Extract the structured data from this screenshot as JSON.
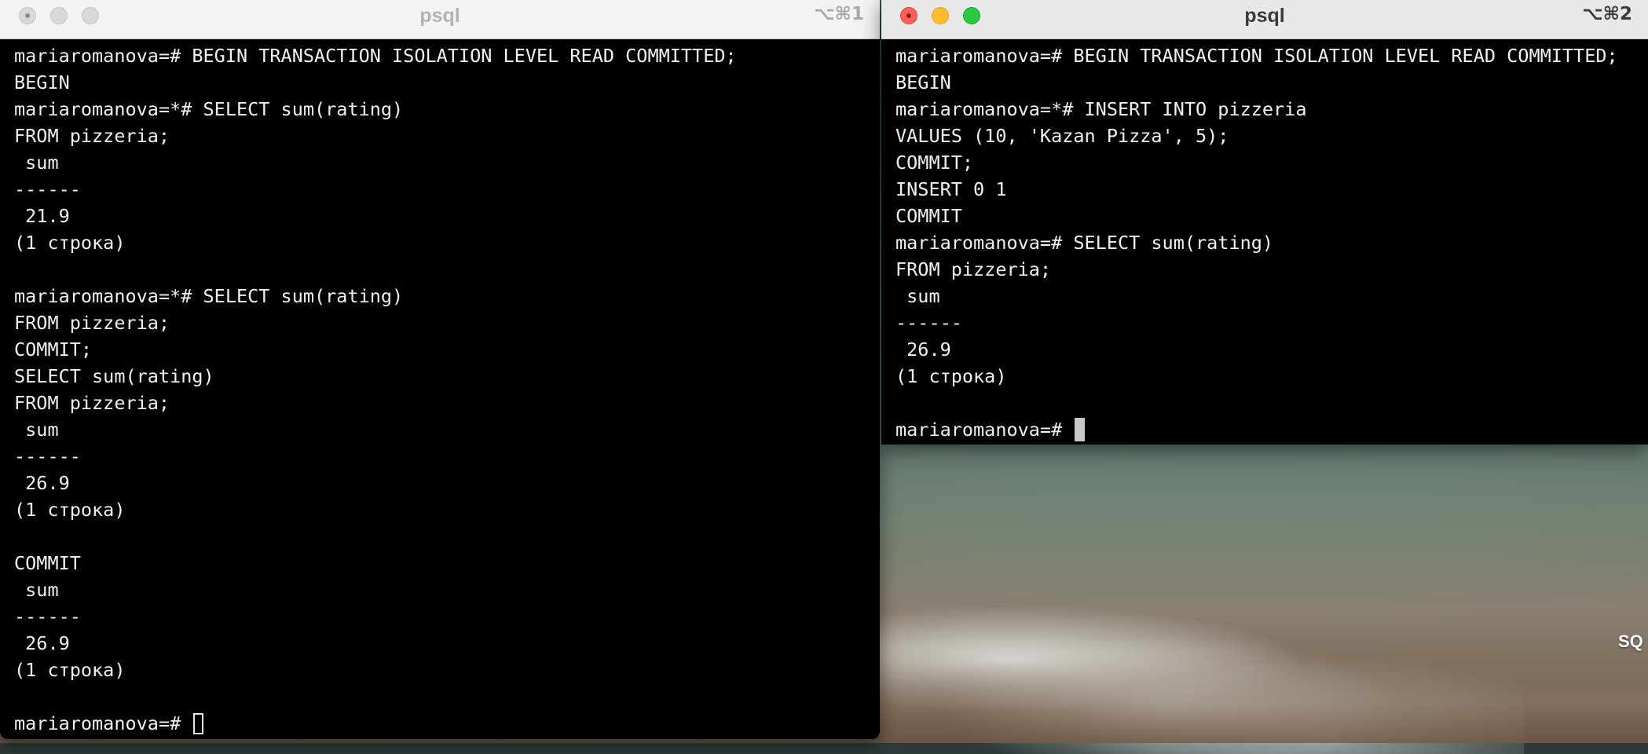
{
  "desktop": {
    "label": "SQ"
  },
  "window1": {
    "title": "psql",
    "shortcut": "⌥⌘1",
    "lines": [
      "mariaromanova=# BEGIN TRANSACTION ISOLATION LEVEL READ COMMITTED;",
      "BEGIN",
      "mariaromanova=*# SELECT sum(rating)",
      "FROM pizzeria;",
      " sum",
      "------",
      " 21.9",
      "(1 строка)",
      "",
      "mariaromanova=*# SELECT sum(rating)",
      "FROM pizzeria;",
      "COMMIT;",
      "SELECT sum(rating)",
      "FROM pizzeria;",
      " sum",
      "------",
      " 26.9",
      "(1 строка)",
      "",
      "COMMIT",
      " sum",
      "------",
      " 26.9",
      "(1 строка)",
      ""
    ],
    "prompt": "mariaromanova=# "
  },
  "window2": {
    "title": "psql",
    "shortcut": "⌥⌘2",
    "lines": [
      "mariaromanova=# BEGIN TRANSACTION ISOLATION LEVEL READ COMMITTED;",
      "BEGIN",
      "mariaromanova=*# INSERT INTO pizzeria",
      "VALUES (10, 'Kazan Pizza', 5);",
      "COMMIT;",
      "INSERT 0 1",
      "COMMIT",
      "mariaromanova=# SELECT sum(rating)",
      "FROM pizzeria;",
      " sum",
      "------",
      " 26.9",
      "(1 строка)",
      ""
    ],
    "prompt": "mariaromanova=# "
  }
}
